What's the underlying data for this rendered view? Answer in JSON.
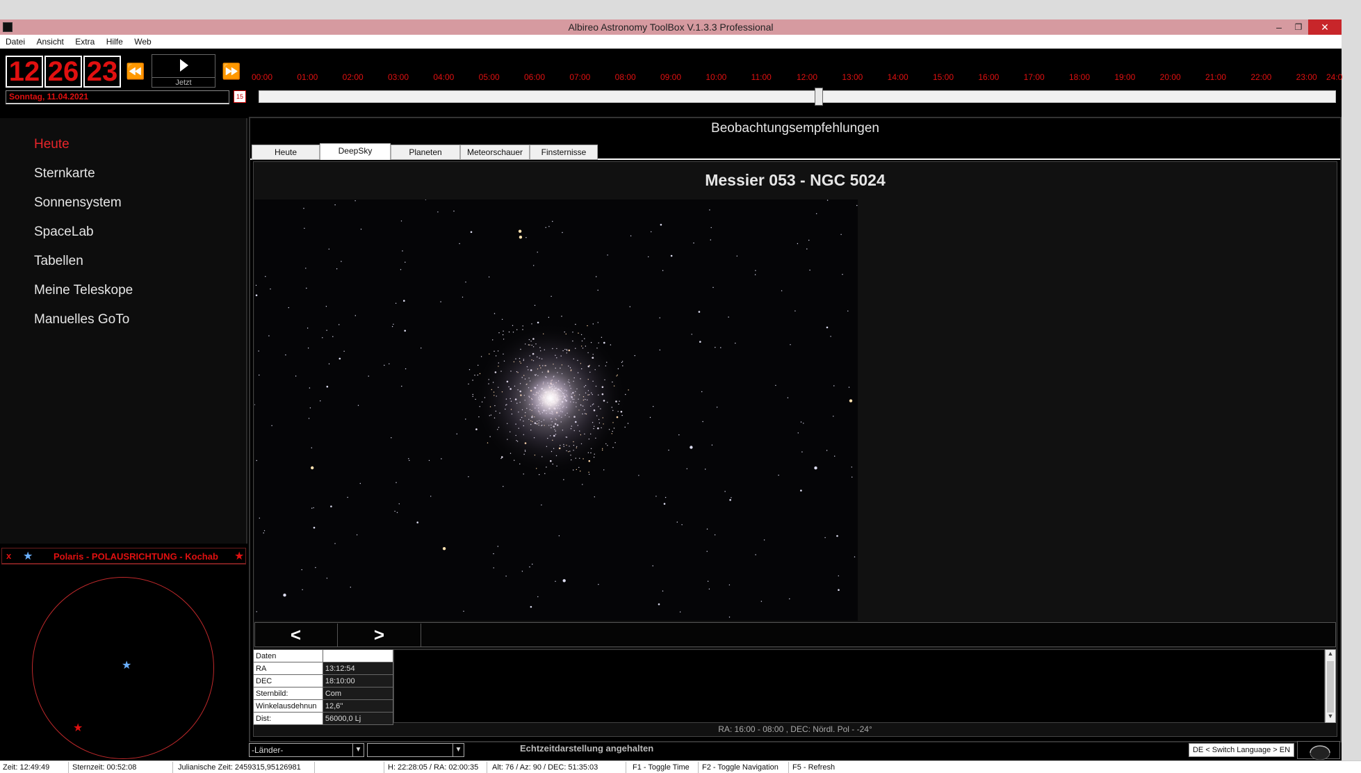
{
  "window": {
    "title": "Albireo Astronomy ToolBox V.1.3.3 Professional",
    "minimize": "–",
    "restore": "❐",
    "close": "✕"
  },
  "menu": [
    "Datei",
    "Ansicht",
    "Extra",
    "Hilfe",
    "Web"
  ],
  "clock": {
    "hours": "12",
    "minutes": "26",
    "seconds": "23",
    "rewind": "⏪",
    "forward": "⏩",
    "now_label": "Jetzt",
    "date": "Sonntag, 11.04.2021",
    "calendar_icon": "15"
  },
  "timeline": {
    "hours": [
      "00:00",
      "01:00",
      "02:00",
      "03:00",
      "04:00",
      "05:00",
      "06:00",
      "07:00",
      "08:00",
      "09:00",
      "10:00",
      "11:00",
      "12:00",
      "13:00",
      "14:00",
      "15:00",
      "16:00",
      "17:00",
      "18:00",
      "19:00",
      "20:00",
      "21:00",
      "22:00",
      "23:00",
      "24:0"
    ],
    "position_fraction": 0.52
  },
  "nav": {
    "items": [
      "Heute",
      "Sternkarte",
      "Sonnensystem",
      "SpaceLab",
      "Tabellen",
      "Meine Teleskope",
      "Manuelles GoTo"
    ],
    "active": "Heute"
  },
  "polaris": {
    "close": "x",
    "title": "Polaris - POLAUSRICHTUNG - Kochab",
    "star_left": "★",
    "star_right": "★"
  },
  "recommendations": {
    "title": "Beobachtungsempfehlungen",
    "tabs": [
      "Heute",
      "DeepSky",
      "Planeten",
      "Meteorschauer",
      "Finsternisse"
    ],
    "active_tab": "DeepSky",
    "object_title": "Messier 053 - NGC 5024",
    "prev_button": "<",
    "next_button": ">",
    "data_header": "Daten",
    "data": [
      {
        "key": "RA",
        "value": "13:12:54"
      },
      {
        "key": "DEC",
        "value": "18:10:00"
      },
      {
        "key": "Sternbild:",
        "value": "Com"
      },
      {
        "key": "Winkelausdehnun",
        "value": "12,6''"
      },
      {
        "key": "Dist:",
        "value": "56000,0 Lj"
      }
    ],
    "coord_note": "RA: 16:00  -  08:00 , DEC: Nördl. Pol  -  -24°"
  },
  "bottom": {
    "country_combo": "-Länder-",
    "city_combo": "",
    "realtime_status": "Echtzeitdarstellung angehalten",
    "language_button": "DE < Switch Language > EN"
  },
  "status": {
    "zeit": "Zeit: 12:49:49",
    "sternzeit": "Sternzeit: 00:52:08",
    "julian": "Julianische Zeit: 2459315,95126981",
    "hra": "H: 22:28:05 / RA: 02:00:35",
    "altaz": "Alt: 76 / Az: 90 / DEC: 51:35:03",
    "f1": "F1 - Toggle Time",
    "f2": "F2 - Toggle Navigation",
    "f5": "F5 - Refresh"
  },
  "colors": {
    "accent_red": "#e01010",
    "titlebar": "#d69aa0",
    "background": "#000000"
  }
}
